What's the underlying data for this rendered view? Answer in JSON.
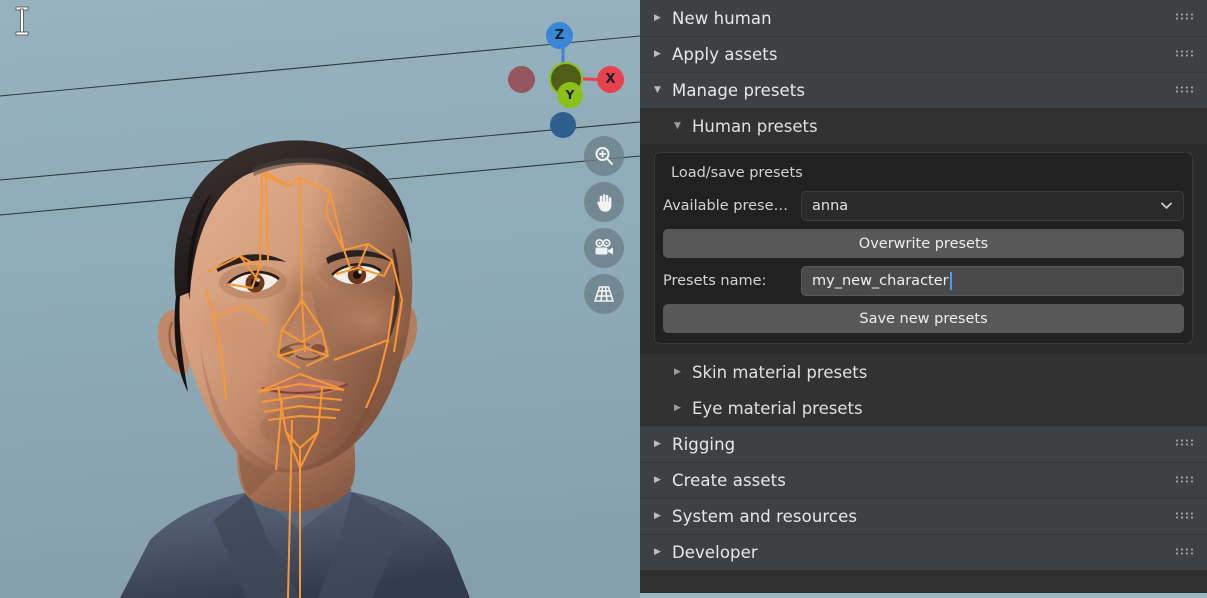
{
  "viewport": {
    "name": "3d-viewport",
    "background_color": "#8eabb8",
    "cursor_icon": "text-ibeam-cursor",
    "rig_color": "#F79838",
    "subject": "male human head with face rig bones",
    "gizmo": {
      "name": "axis-gizmo",
      "axes": [
        {
          "label": "Z",
          "color": "#3a87d8",
          "filled": true
        },
        {
          "label": "X",
          "color": "#e8414f",
          "filled": true
        },
        {
          "label": "Y",
          "color": "#8bc019",
          "filled": true
        },
        {
          "label": "",
          "color": "#9b5560",
          "filled": false
        },
        {
          "label": "",
          "color": "#2e5f8e",
          "filled": false
        },
        {
          "label": "",
          "color": "#5d6b1d",
          "filled": false
        }
      ]
    },
    "nav_buttons": [
      {
        "icon": "zoom-in-icon",
        "label": "Zoom"
      },
      {
        "icon": "hand-pan-icon",
        "label": "Pan"
      },
      {
        "icon": "camera-icon",
        "label": "Camera view"
      },
      {
        "icon": "grid-perspective-icon",
        "label": "Toggle perspective/ortho"
      }
    ]
  },
  "sidebar": {
    "name": "humgen-sidebar",
    "panels": [
      {
        "label": "New human",
        "expanded": false,
        "tri": "▶",
        "grip": true
      },
      {
        "label": "Apply assets",
        "expanded": false,
        "tri": "▶",
        "grip": true
      },
      {
        "label": "Manage presets",
        "expanded": true,
        "tri": "▼",
        "grip": true
      }
    ],
    "subpanels": [
      {
        "label": "Human presets",
        "expanded": true,
        "tri": "▼"
      },
      {
        "label": "Skin material presets",
        "expanded": false,
        "tri": "▶"
      },
      {
        "label": "Eye material presets",
        "expanded": false,
        "tri": "▶"
      }
    ],
    "panels_bottom": [
      {
        "label": "Rigging",
        "expanded": false,
        "tri": "▶",
        "grip": true
      },
      {
        "label": "Create assets",
        "expanded": false,
        "tri": "▶",
        "grip": true
      },
      {
        "label": "System and resources",
        "expanded": false,
        "tri": "▶",
        "grip": true
      },
      {
        "label": "Developer",
        "expanded": false,
        "tri": "▶",
        "grip": true
      }
    ],
    "load_save_box": {
      "title": "Load/save presets",
      "available_label": "Available prese…",
      "available_value": "anna",
      "overwrite_button": "Overwrite presets",
      "presets_name_label": "Presets name:",
      "presets_name_value": "my_new_character",
      "save_button": "Save new presets",
      "caret_color": "#4f9ae8"
    }
  }
}
